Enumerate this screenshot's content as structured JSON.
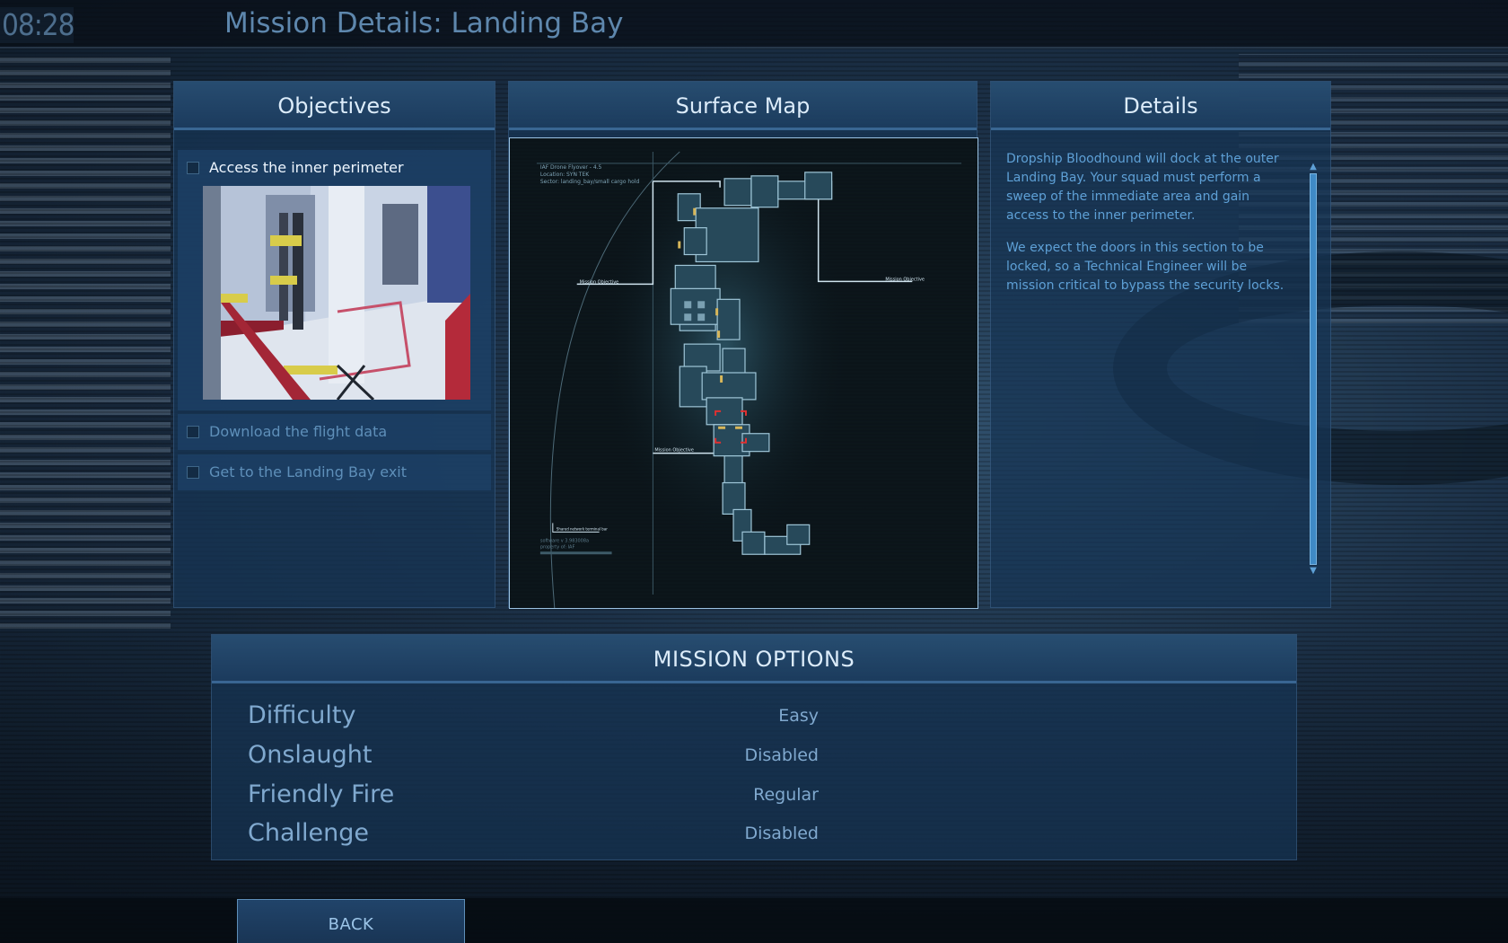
{
  "timer": "08:28",
  "title": "Mission Details: Landing Bay",
  "objectives": {
    "header": "Objectives",
    "items": [
      {
        "label": "Access the inner perimeter",
        "checked": false
      },
      {
        "label": "Download the flight data",
        "checked": false
      },
      {
        "label": "Get to the Landing Bay exit",
        "checked": false
      }
    ]
  },
  "surface_map": {
    "header": "Surface Map",
    "info": [
      "IAF Drone Flyover - 4.5",
      "Location: SYN TEK",
      "Sector: landing_bay/small cargo hold"
    ],
    "footer": [
      "software v 3.983008a",
      "property of: IAF"
    ],
    "labels": {
      "mission_objective_left": "Mission Objective",
      "mission_objective_right": "Mission Objective",
      "mission_objective_mid": "Mission Objective",
      "bottom_left": "Shared network terminal bar"
    }
  },
  "details": {
    "header": "Details",
    "paragraphs": [
      "Dropship Bloodhound will dock at the outer Landing Bay.  Your squad must perform a sweep of the immediate area and gain access to the inner perimeter.",
      "We expect the doors in this section to be locked, so a Technical Engineer will be mission critical to bypass the security locks."
    ]
  },
  "mission_options": {
    "header": "MISSION OPTIONS",
    "rows": [
      {
        "label": "Difficulty",
        "value": "Easy"
      },
      {
        "label": "Onslaught",
        "value": "Disabled"
      },
      {
        "label": "Friendly Fire",
        "value": "Regular"
      },
      {
        "label": "Challenge",
        "value": "Disabled"
      }
    ]
  },
  "back_button": "BACK"
}
